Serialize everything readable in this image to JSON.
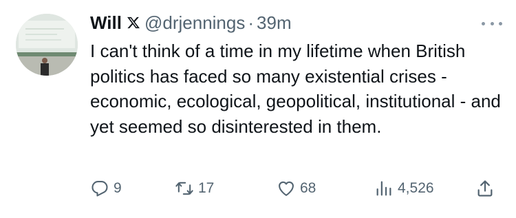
{
  "tweet": {
    "author_name": "Will",
    "verified_icon": "x-logo-icon",
    "handle": "@drjennings",
    "separator": "·",
    "time": "39m",
    "text": "I can't think of a time in my lifetime when British politics has faced so many existential crises - economic, ecological, geopolitical, institutional - and yet seemed so disinterested in them."
  },
  "actions": {
    "replies": "9",
    "retweets": "17",
    "likes": "68",
    "views": "4,526"
  },
  "icons": {
    "reply": "reply-bubble-icon",
    "retweet": "retweet-icon",
    "like": "heart-icon",
    "views": "views-chart-icon",
    "share": "share-icon",
    "more": "more-options-icon"
  },
  "colors": {
    "text": "#0f1419",
    "secondary": "#536471",
    "background": "#ffffff"
  }
}
